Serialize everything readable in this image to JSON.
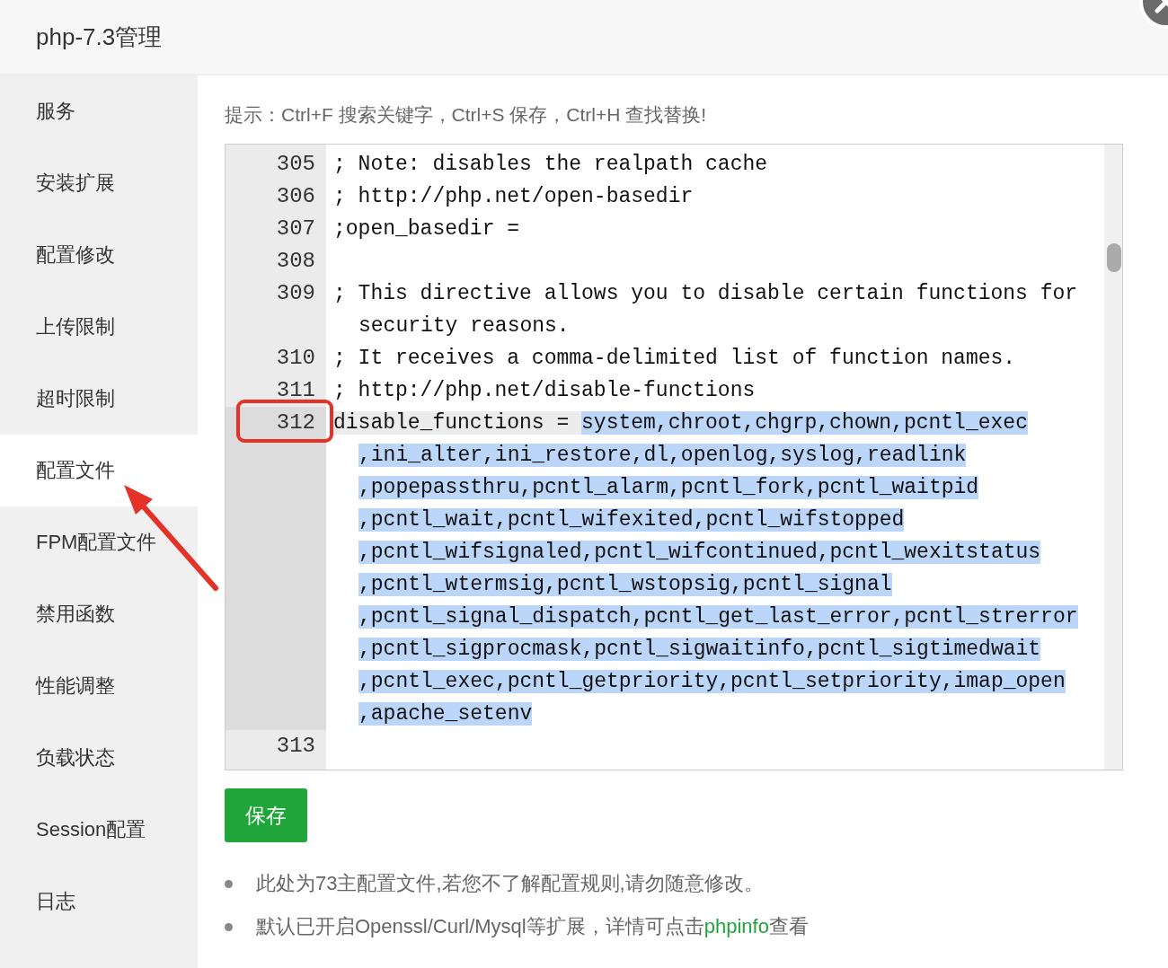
{
  "window": {
    "title": "php-7.3管理"
  },
  "sidebar": {
    "items": [
      {
        "label": "服务",
        "selected": false
      },
      {
        "label": "安装扩展",
        "selected": false
      },
      {
        "label": "配置修改",
        "selected": false
      },
      {
        "label": "上传限制",
        "selected": false
      },
      {
        "label": "超时限制",
        "selected": false
      },
      {
        "label": "配置文件",
        "selected": true
      },
      {
        "label": "FPM配置文件",
        "selected": false
      },
      {
        "label": "禁用函数",
        "selected": false
      },
      {
        "label": "性能调整",
        "selected": false
      },
      {
        "label": "负载状态",
        "selected": false
      },
      {
        "label": "Session配置",
        "selected": false
      },
      {
        "label": "日志",
        "selected": false
      }
    ]
  },
  "hint": "提示：Ctrl+F 搜索关键字，Ctrl+S 保存，Ctrl+H 查找替换!",
  "editor": {
    "lines": [
      {
        "number": "305",
        "active": false,
        "rows": [
          {
            "plain": "; Note: disables the realpath cache"
          }
        ]
      },
      {
        "number": "306",
        "active": false,
        "rows": [
          {
            "plain": "; http://php.net/open-basedir"
          }
        ]
      },
      {
        "number": "307",
        "active": false,
        "rows": [
          {
            "plain": ";open_basedir ="
          }
        ]
      },
      {
        "number": "308",
        "active": false
      },
      {
        "number": "309",
        "active": false,
        "rows": [
          {
            "plain": "; This directive allows you to disable certain functions for"
          },
          {
            "plain": "security reasons."
          }
        ]
      },
      {
        "number": "310",
        "active": false,
        "rows": [
          {
            "plain": "; It receives a comma-delimited list of function names."
          }
        ]
      },
      {
        "number": "311",
        "active": false,
        "rows": [
          {
            "plain": "; http://php.net/disable-functions"
          }
        ]
      },
      {
        "number": "312",
        "active": true,
        "rows": [
          {
            "plain": "disable_functions = ",
            "selected": "system,chroot,chgrp,chown,pcntl_exec"
          },
          {
            "selected": ",ini_alter,ini_restore,dl,openlog,syslog,readlink"
          },
          {
            "selected": ",popepassthru,pcntl_alarm,pcntl_fork,pcntl_waitpid"
          },
          {
            "selected": ",pcntl_wait,pcntl_wifexited,pcntl_wifstopped"
          },
          {
            "selected": ",pcntl_wifsignaled,pcntl_wifcontinued,pcntl_wexitstatus"
          },
          {
            "selected": ",pcntl_wtermsig,pcntl_wstopsig,pcntl_signal"
          },
          {
            "selected": ",pcntl_signal_dispatch,pcntl_get_last_error,pcntl_strerror"
          },
          {
            "selected": ",pcntl_sigprocmask,pcntl_sigwaitinfo,pcntl_sigtimedwait"
          },
          {
            "selected": ",pcntl_exec,pcntl_getpriority,pcntl_setpriority,imap_open"
          },
          {
            "selected": ",apache_setenv"
          }
        ]
      },
      {
        "number": "313",
        "active": false
      }
    ]
  },
  "save_button": "保存",
  "notes": [
    {
      "before": "此处为73主配置文件,若您不了解配置规则,请勿随意修改。"
    },
    {
      "before": "默认已开启Openssl/Curl/Mysql等扩展，详情可点击",
      "link": "phpinfo",
      "after": "查看"
    }
  ]
}
